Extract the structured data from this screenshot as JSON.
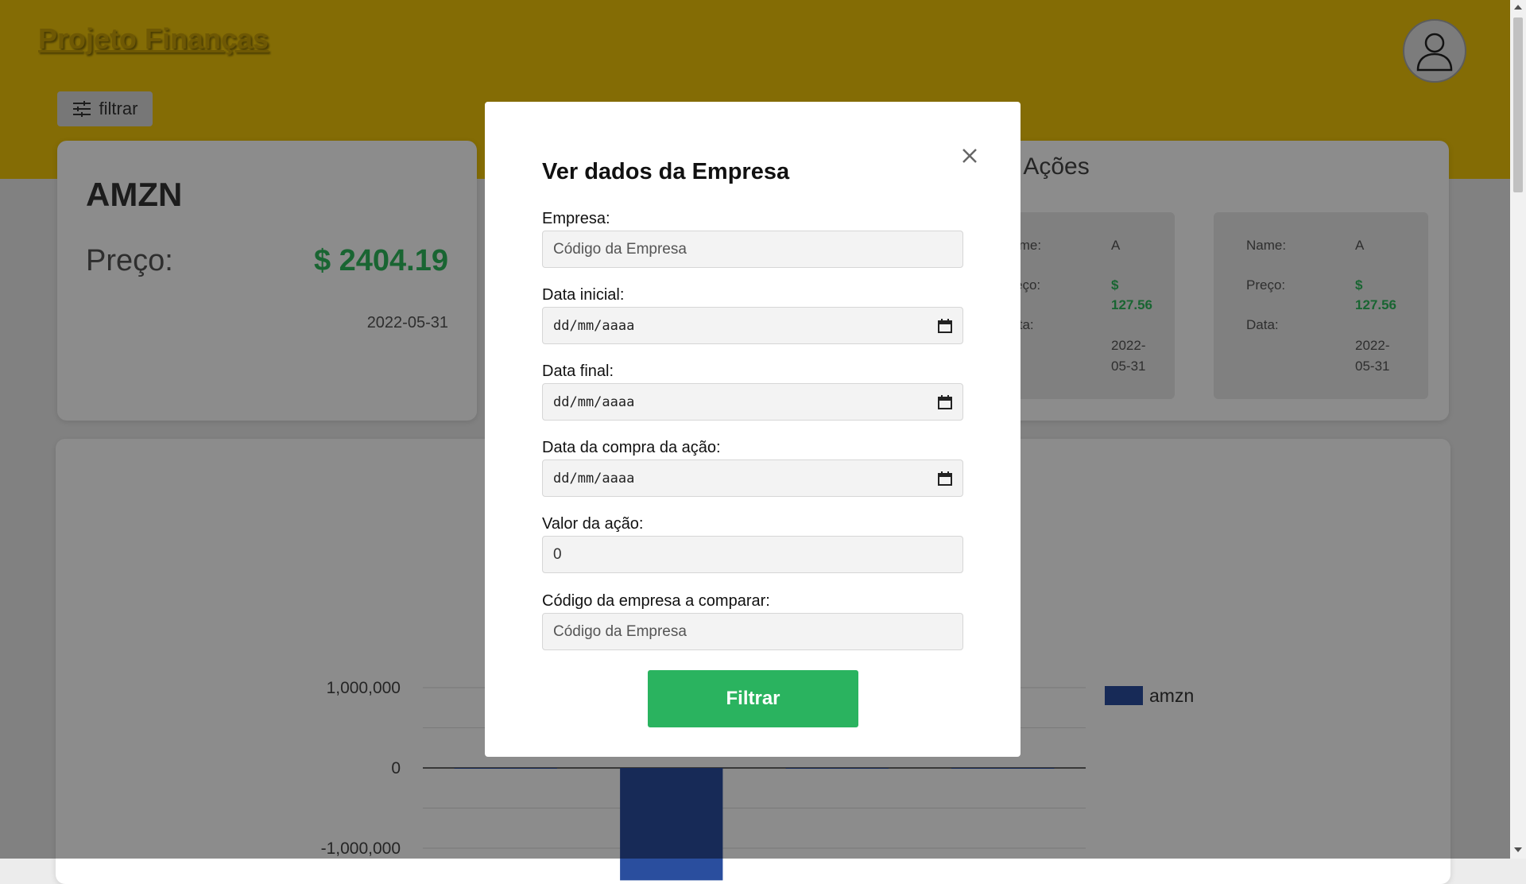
{
  "app": {
    "title": "Projeto Finanças"
  },
  "header": {
    "filter_button_label": "filtrar",
    "bg_color": "#f0c50a"
  },
  "stock_card": {
    "symbol": "AMZN",
    "price_label": "Preço:",
    "price_value": "$ 2404.19",
    "date": "2022-05-31"
  },
  "actions_card": {
    "title": "e Ações",
    "items": [
      {
        "name_label": "Name:",
        "name_value": "A",
        "price_label": "Preço:",
        "price_line1": "$",
        "price_line2": "127.56",
        "date_label": "Data:",
        "date_line1": "2022-",
        "date_line2": "05-31"
      },
      {
        "name_label": "Name:",
        "name_value": "A",
        "price_label": "Preço:",
        "price_line1": "$",
        "price_line2": "127.56",
        "date_label": "Data:",
        "date_line1": "2022-",
        "date_line2": "05-31"
      }
    ]
  },
  "chart_data": {
    "type": "bar",
    "categories": [
      "",
      "",
      "",
      ""
    ],
    "series": [
      {
        "name": "amzn",
        "values": [
          0,
          -1400000,
          0,
          0
        ],
        "color": "#2a4e9e"
      }
    ],
    "yticks": [
      "1,000,000",
      "0",
      "-1,000,000"
    ],
    "ylim": [
      -1000000,
      1000000
    ],
    "legend_position": "right"
  },
  "modal": {
    "title": "Ver dados da Empresa",
    "fields": {
      "empresa": {
        "label": "Empresa:",
        "placeholder": "Código da Empresa",
        "value": ""
      },
      "data_inicial": {
        "label": "Data inicial:",
        "value": "dd/mm/aaaa"
      },
      "data_final": {
        "label": "Data final:",
        "value": "dd/mm/aaaa"
      },
      "data_compra": {
        "label": "Data da compra da ação:",
        "value": "dd/mm/aaaa"
      },
      "valor_acao": {
        "label": "Valor da ação:",
        "value": "0"
      },
      "codigo_comparar": {
        "label": "Código da empresa a comparar:",
        "placeholder": "Código da Empresa",
        "value": ""
      }
    },
    "submit_label": "Filtrar"
  },
  "colors": {
    "accent_green": "#2ab35f",
    "header_yellow": "#f0c50a",
    "bar_blue": "#2a4e9e"
  }
}
